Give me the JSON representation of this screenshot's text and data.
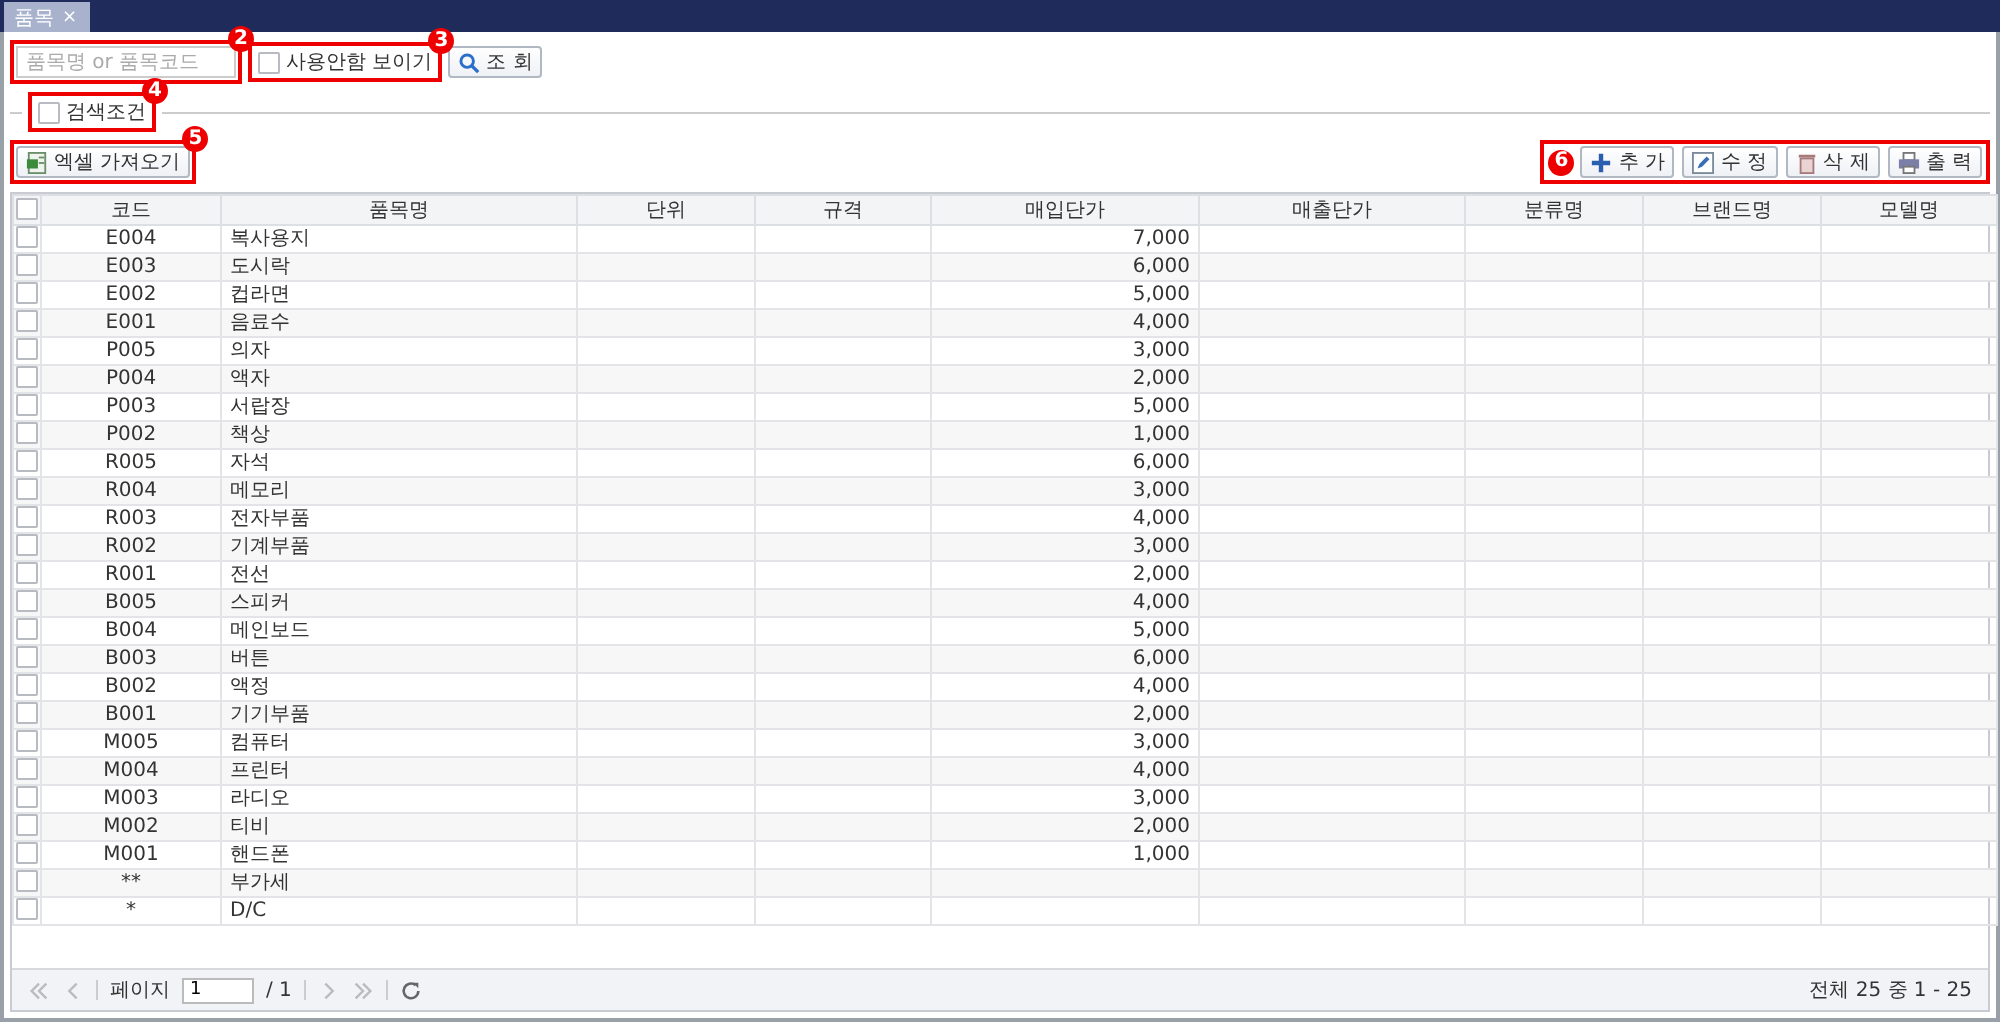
{
  "tabs": [
    {
      "label": "품목",
      "selected": true,
      "close": "×"
    }
  ],
  "search": {
    "placeholder": "품목명 or 품목코드",
    "badge": "2"
  },
  "show_unused": {
    "label": "사용안함 보이기",
    "checked": false,
    "badge": "3"
  },
  "search_button": {
    "label": "조 회"
  },
  "search_conditions": {
    "label": "검색조건",
    "checked": false,
    "badge": "4"
  },
  "excel_button": {
    "label": "엑셀 가져오기",
    "badge": "5"
  },
  "actions": {
    "badge": "6",
    "items": [
      {
        "kind": "add",
        "label": "추 가"
      },
      {
        "kind": "edit",
        "label": "수 정"
      },
      {
        "kind": "delete",
        "label": "삭 제"
      },
      {
        "kind": "print",
        "label": "출 력"
      }
    ]
  },
  "table": {
    "all_checked": false,
    "columns": [
      "코드",
      "품목명",
      "단위",
      "규격",
      "매입단가",
      "매출단가",
      "분류명",
      "브랜드명",
      "모델명"
    ],
    "rows": [
      {
        "checked": false,
        "code": "E004",
        "name": "복사용지",
        "purchase_price": "7,000"
      },
      {
        "checked": false,
        "code": "E003",
        "name": "도시락",
        "purchase_price": "6,000"
      },
      {
        "checked": false,
        "code": "E002",
        "name": "컵라면",
        "purchase_price": "5,000"
      },
      {
        "checked": false,
        "code": "E001",
        "name": "음료수",
        "purchase_price": "4,000"
      },
      {
        "checked": false,
        "code": "P005",
        "name": "의자",
        "purchase_price": "3,000"
      },
      {
        "checked": false,
        "code": "P004",
        "name": "액자",
        "purchase_price": "2,000"
      },
      {
        "checked": false,
        "code": "P003",
        "name": "서랍장",
        "purchase_price": "5,000"
      },
      {
        "checked": false,
        "code": "P002",
        "name": "책상",
        "purchase_price": "1,000"
      },
      {
        "checked": false,
        "code": "R005",
        "name": "자석",
        "purchase_price": "6,000"
      },
      {
        "checked": false,
        "code": "R004",
        "name": "메모리",
        "purchase_price": "3,000"
      },
      {
        "checked": false,
        "code": "R003",
        "name": "전자부품",
        "purchase_price": "4,000"
      },
      {
        "checked": false,
        "code": "R002",
        "name": "기계부품",
        "purchase_price": "3,000"
      },
      {
        "checked": false,
        "code": "R001",
        "name": "전선",
        "purchase_price": "2,000"
      },
      {
        "checked": false,
        "code": "B005",
        "name": "스피커",
        "purchase_price": "4,000"
      },
      {
        "checked": false,
        "code": "B004",
        "name": "메인보드",
        "purchase_price": "5,000"
      },
      {
        "checked": false,
        "code": "B003",
        "name": "버튼",
        "purchase_price": "6,000"
      },
      {
        "checked": false,
        "code": "B002",
        "name": "액정",
        "purchase_price": "4,000"
      },
      {
        "checked": false,
        "code": "B001",
        "name": "기기부품",
        "purchase_price": "2,000"
      },
      {
        "checked": false,
        "code": "M005",
        "name": "컴퓨터",
        "purchase_price": "3,000"
      },
      {
        "checked": false,
        "code": "M004",
        "name": "프린터",
        "purchase_price": "4,000"
      },
      {
        "checked": false,
        "code": "M003",
        "name": "라디오",
        "purchase_price": "3,000"
      },
      {
        "checked": false,
        "code": "M002",
        "name": "티비",
        "purchase_price": "2,000"
      },
      {
        "checked": false,
        "code": "M001",
        "name": "핸드폰",
        "purchase_price": "1,000"
      },
      {
        "checked": false,
        "code": "**",
        "name": "부가세"
      },
      {
        "checked": false,
        "code": "*",
        "name": "D/C"
      }
    ]
  },
  "pager": {
    "page_label": "페이지",
    "page": "1",
    "total_pages": "/ 1",
    "summary": "전체 25 중 1 - 25"
  }
}
